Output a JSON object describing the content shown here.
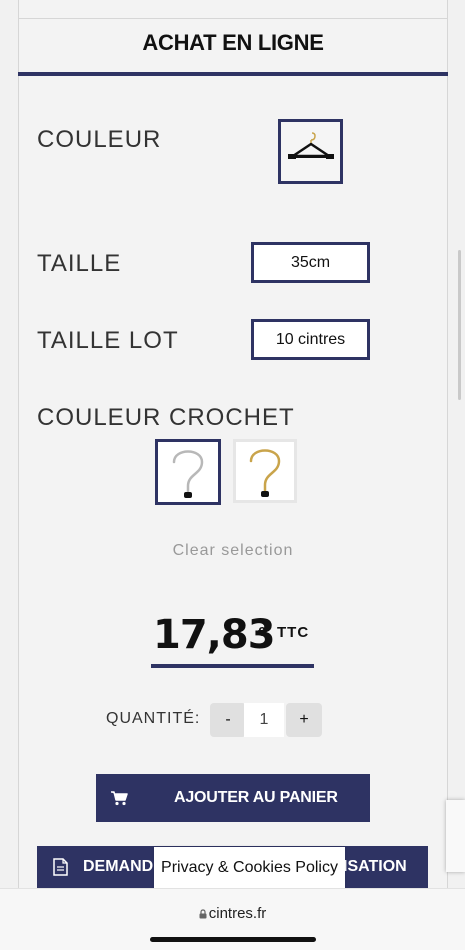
{
  "page": {
    "title": "ACHAT EN LIGNE"
  },
  "options": {
    "color_label": "COULEUR",
    "size_label": "TAILLE",
    "size_value": "35cm",
    "lot_label": "TAILLE LOT",
    "lot_value": "10 cintres",
    "hook_label": "COULEUR CROCHET",
    "clear_label": "Clear selection"
  },
  "price": {
    "amount": "17,83",
    "currency": "€",
    "tax_label": "TTC"
  },
  "quantity": {
    "label": "QUANTITÉ:",
    "minus": "-",
    "value": "1",
    "plus": "+"
  },
  "actions": {
    "cart_label": "AJOUTER AU PANIER",
    "quote_label_left": "DEMANDE",
    "quote_label_right": "ISATION"
  },
  "privacy": {
    "label": "Privacy & Cookies Policy"
  },
  "browser": {
    "url": "cintres.fr"
  },
  "colors": {
    "accent": "#2e3363"
  }
}
